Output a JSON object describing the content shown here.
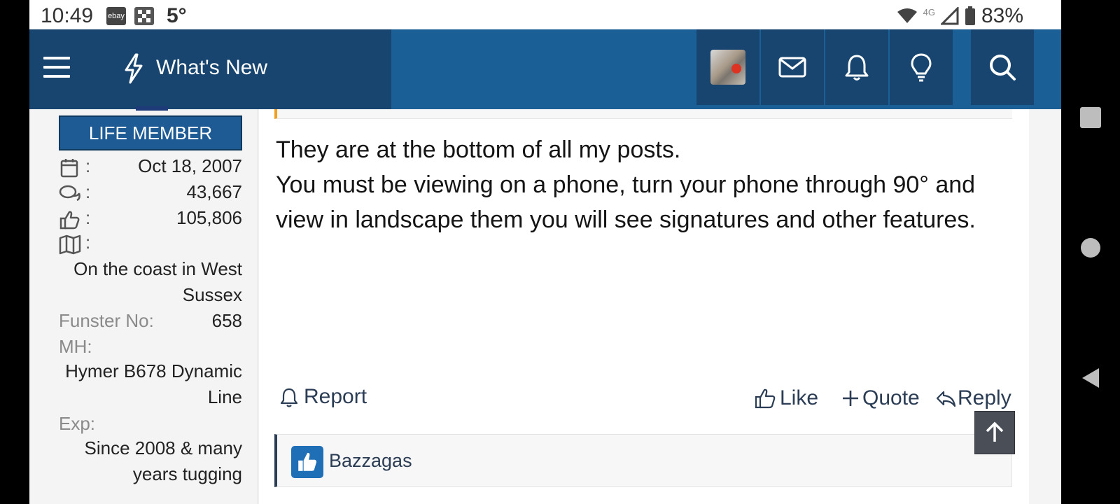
{
  "status_bar": {
    "time": "10:49",
    "app_icon_label": "ebay",
    "temperature": "5°",
    "network": "4G",
    "battery": "83%"
  },
  "header": {
    "title": "What's New"
  },
  "sidebar": {
    "badge": "LIFE MEMBER",
    "stats": [
      {
        "icon": "calendar-icon",
        "value": "Oct 18, 2007"
      },
      {
        "icon": "messages-icon",
        "value": "43,667"
      },
      {
        "icon": "thumbs-up-icon",
        "value": "105,806"
      },
      {
        "icon": "map-icon",
        "value": ""
      }
    ],
    "location": "On the coast in West Sussex",
    "location_line1": "On the coast in West",
    "location_line2": "Sussex",
    "funster_label": "Funster No:",
    "funster_value": "658",
    "mh_label": "MH:",
    "mh_line1": "Hymer B678 Dynamic",
    "mh_line2": "Line",
    "exp_label": "Exp:",
    "exp_line1": "Since 2008 & many",
    "exp_line2": "years tugging"
  },
  "post": {
    "line1": "They are at the bottom of all my posts.",
    "line2": "You must be viewing on a phone, turn your phone through 90° and view in landscape them you will see signatures and other features.",
    "actions": {
      "report": "Report",
      "like": "Like",
      "quote": "Quote",
      "reply": "Reply"
    },
    "reactions": {
      "user": "Bazzagas"
    }
  },
  "colors": {
    "header_dark": "#17456f",
    "header": "#1b5f97",
    "badge": "#1e5b94",
    "quote_accent": "#f0a020",
    "action_text": "#2b3d55"
  }
}
